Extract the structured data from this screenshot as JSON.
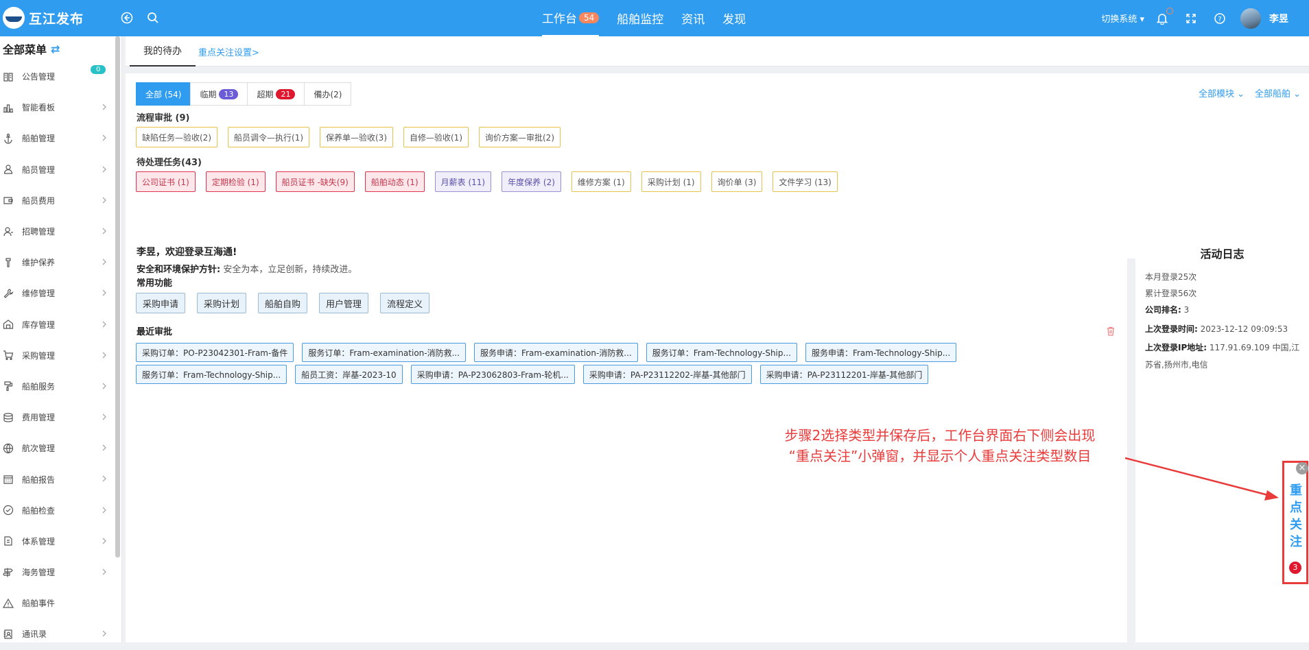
{
  "topbar": {
    "app_name": "互江发布",
    "nav": [
      {
        "label": "工作台",
        "badge": "54"
      },
      {
        "label": "船舶监控"
      },
      {
        "label": "资讯"
      },
      {
        "label": "发现"
      }
    ],
    "switch_system": "切换系统",
    "user_name": "李昱"
  },
  "sidebar": {
    "title": "全部菜单",
    "items": [
      {
        "label": "公告管理",
        "icon": "notice-icon",
        "badge": "0"
      },
      {
        "label": "智能看板",
        "icon": "chart-icon"
      },
      {
        "label": "船舶管理",
        "icon": "anchor-icon"
      },
      {
        "label": "船员管理",
        "icon": "crew-icon"
      },
      {
        "label": "船员费用",
        "icon": "wallet-icon"
      },
      {
        "label": "招聘管理",
        "icon": "recruit-icon"
      },
      {
        "label": "维护保养",
        "icon": "tool-icon"
      },
      {
        "label": "维修管理",
        "icon": "wrench-icon"
      },
      {
        "label": "库存管理",
        "icon": "warehouse-icon"
      },
      {
        "label": "采购管理",
        "icon": "cart-icon"
      },
      {
        "label": "船舶服务",
        "icon": "service-icon"
      },
      {
        "label": "费用管理",
        "icon": "coins-icon"
      },
      {
        "label": "航次管理",
        "icon": "globe-icon"
      },
      {
        "label": "船舶报告",
        "icon": "calendar-icon"
      },
      {
        "label": "船舶检查",
        "icon": "check-icon"
      },
      {
        "label": "体系管理",
        "icon": "system-icon"
      },
      {
        "label": "海务管理",
        "icon": "signpost-icon"
      },
      {
        "label": "船舶事件",
        "icon": "warning-icon"
      },
      {
        "label": "通讯录",
        "icon": "contacts-icon"
      }
    ]
  },
  "tabs": {
    "mine": "我的待办",
    "focus": "重点关注设置>"
  },
  "todo": {
    "filters": [
      {
        "label": "全部 (54)"
      },
      {
        "label": "临期",
        "badge": "13",
        "color": "#6b5bd6"
      },
      {
        "label": "超期",
        "badge": "21",
        "color": "#e0182f"
      },
      {
        "label": "備办(2)"
      }
    ],
    "module_dd": "全部模块",
    "ship_dd": "全部船舶",
    "flow_title": "流程审批 (9)",
    "flow_tags": [
      "缺陷任务—验收(2)",
      "船员调令—执行(1)",
      "保养单—验收(3)",
      "自修—验收(1)",
      "询价方案—审批(2)"
    ],
    "pending_title": "待处理任务(43)",
    "pending_tags": [
      {
        "label": "公司证书 (1)",
        "style": "red"
      },
      {
        "label": "定期检验 (1)",
        "style": "red"
      },
      {
        "label": "船员证书 -缺失(9)",
        "style": "red"
      },
      {
        "label": "船舶动态 (1)",
        "style": "red"
      },
      {
        "label": "月薪表 (11)",
        "style": "purple"
      },
      {
        "label": "年度保养 (2)",
        "style": "purple"
      },
      {
        "label": "维修方案 (1)",
        "style": "yellow"
      },
      {
        "label": "采购计划 (1)",
        "style": "yellow"
      },
      {
        "label": "询价单 (3)",
        "style": "yellow"
      },
      {
        "label": "文件学习 (13)",
        "style": "yellow"
      }
    ]
  },
  "welcome": {
    "title": "李昱，欢迎登录互海通!",
    "policy_label": "安全和环境保护方针:",
    "policy_text": "安全为本，立足创新，持续改进。",
    "common_title": "常用功能",
    "quick": [
      "采购申请",
      "采购计划",
      "船舶自购",
      "用户管理",
      "流程定义"
    ],
    "recent_title": "最近审批",
    "recent_row1": [
      "采购订单：PO-P23042301-Fram-备件",
      "服务订单：Fram-examination-消防救...",
      "服务申请：Fram-examination-消防救...",
      "服务订单：Fram-Technology-Ship...",
      "服务申请：Fram-Technology-Ship..."
    ],
    "recent_row2": [
      "服务订单：Fram-Technology-Ship...",
      "船员工资：岸基-2023-10",
      "采购申请：PA-P23062803-Fram-轮机...",
      "采购申请：PA-P23112202-岸基-其他部门",
      "采购申请：PA-P23112201-岸基-其他部门"
    ]
  },
  "activity": {
    "title": "活动日志",
    "month_label": "本月登录",
    "month_value": "25",
    "month_unit": "次",
    "total_label": "累计登录",
    "total_value": "56",
    "total_unit": "次",
    "rank_label": "公司排名:",
    "rank_value": "3",
    "last_time_label": "上次登录时间:",
    "last_time_value": "2023-12-12 09:09:53",
    "last_ip_label": "上次登录IP地址:",
    "last_ip_value": "117.91.69.109 中国,江苏省,扬州市,电信"
  },
  "annotation": {
    "line1": "步骤2选择类型并保存后，工作台界面右下侧会出现",
    "line2": "“重点关注”小弹窗，并显示个人重点关注类型数目"
  },
  "focus_popup": {
    "text": "重点关注",
    "count": "3"
  },
  "colors": {
    "primary": "#2f9cf0",
    "annotation": "#ea3b3b",
    "badge_orange": "#f6875e"
  }
}
